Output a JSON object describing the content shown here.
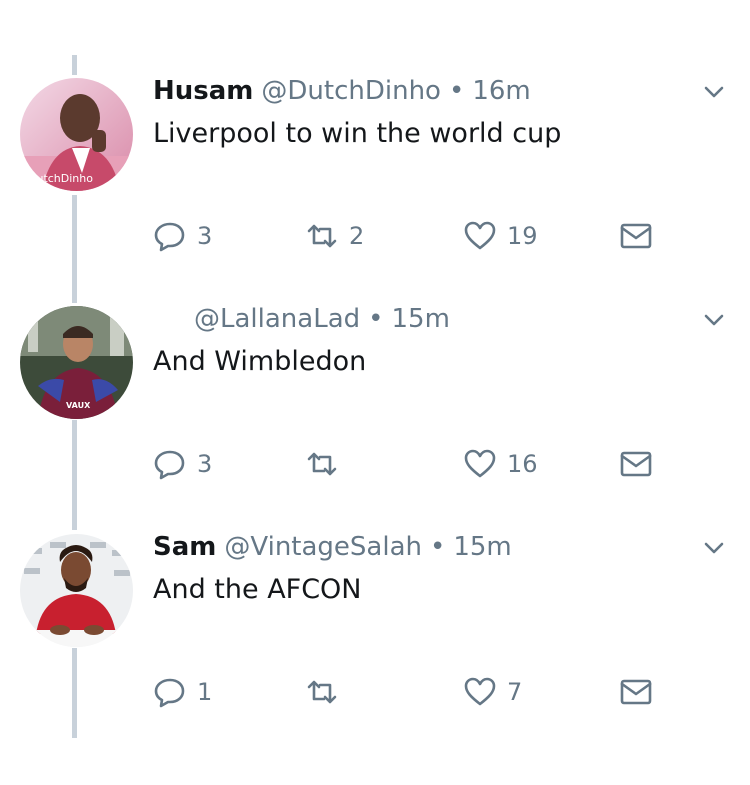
{
  "tweets": [
    {
      "name": "Husam",
      "handle": "@DutchDinho",
      "dot": "•",
      "time": "16m",
      "text": "Liverpool to win the world cup",
      "replies": "3",
      "retweets": "2",
      "likes": "19",
      "avatar_text": "DutchDinho"
    },
    {
      "name": "",
      "handle": "@LallanaLad",
      "dot": "•",
      "time": "15m",
      "text": "And Wimbledon",
      "replies": "3",
      "retweets": "",
      "likes": "16",
      "avatar_text": "VAUX"
    },
    {
      "name": "Sam",
      "handle": "@VintageSalah",
      "dot": "•",
      "time": "15m",
      "text": "And the AFCON",
      "replies": "1",
      "retweets": "",
      "likes": "7",
      "avatar_text": ""
    }
  ],
  "icons": {
    "reply": "reply-icon",
    "retweet": "retweet-icon",
    "like": "heart-icon",
    "dm": "envelope-icon",
    "menu": "chevron-down-icon"
  },
  "colors": {
    "text": "#14171a",
    "muted": "#657786",
    "thread_line": "#c8d1da"
  }
}
